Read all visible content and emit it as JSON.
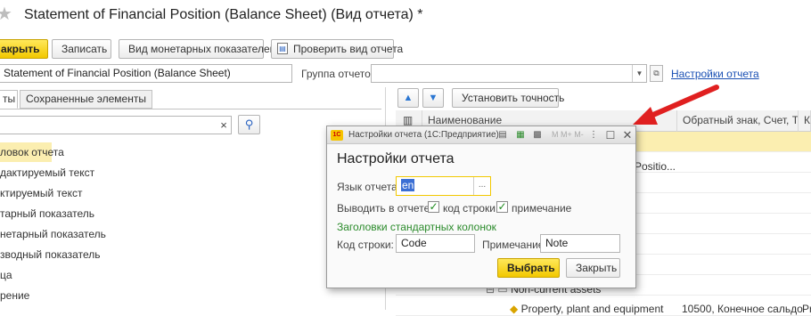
{
  "window": {
    "title": "Statement of Financial Position (Balance Sheet) (Вид отчета) *"
  },
  "toolbar": {
    "close_label": "акрыть",
    "save_label": "Записать",
    "monetary_label": "Вид монетарных показателей",
    "check_label": "Проверить вид отчета"
  },
  "form": {
    "name_value": "Statement of Financial Position (Balance Sheet)",
    "group_label": "Группа отчетов:",
    "group_value": "",
    "settings_link": "Настройки отчета"
  },
  "tabs": {
    "first": "ты",
    "saved": "Сохраненные элементы"
  },
  "search": {
    "clear": "×",
    "value": ""
  },
  "left_list": [
    "ловок отчета",
    "дактируемый текст",
    "ктируемый текст",
    "тарный показатель",
    "нетарный показатель",
    "зводный показатель",
    "ца",
    "рение"
  ],
  "right_toolbar": {
    "precision_label": "Установить точность"
  },
  "grid": {
    "columns": [
      "Наименование",
      "Обратный знак, Счет, Т...",
      "Ко"
    ],
    "visible_fragments": {
      "row1_partial": "Positio...",
      "row_nca": "Non-current assets",
      "row_ppe": "Property, plant and equipment",
      "row_ppe_col2": "10500, Конечное сальдо",
      "row_ppe_col3": "Pr"
    }
  },
  "dialog": {
    "title": "Настройки отчета (1С:Предприятие)",
    "heading": "Настройки отчета",
    "lang_label": "Язык отчета:",
    "lang_value": "en",
    "lang_button": "...",
    "output_label": "Выводить в отчете:",
    "cb_row_code_label": "код строки",
    "cb_note_label": "примечание",
    "section_label": "Заголовки стандартных колонок",
    "code_label": "Код строки:",
    "code_value": "Code",
    "note_label": "Примечание:",
    "note_value": "Note",
    "ok_label": "Выбрать",
    "cancel_label": "Закрыть",
    "titlebar_letters": "M M+ M-"
  },
  "colors": {
    "accent_yellow": "#f2c800",
    "selected_row": "#fbeeb0",
    "link": "#1a50b4",
    "arrow": "#e02020",
    "section_green": "#2a8a2a"
  }
}
